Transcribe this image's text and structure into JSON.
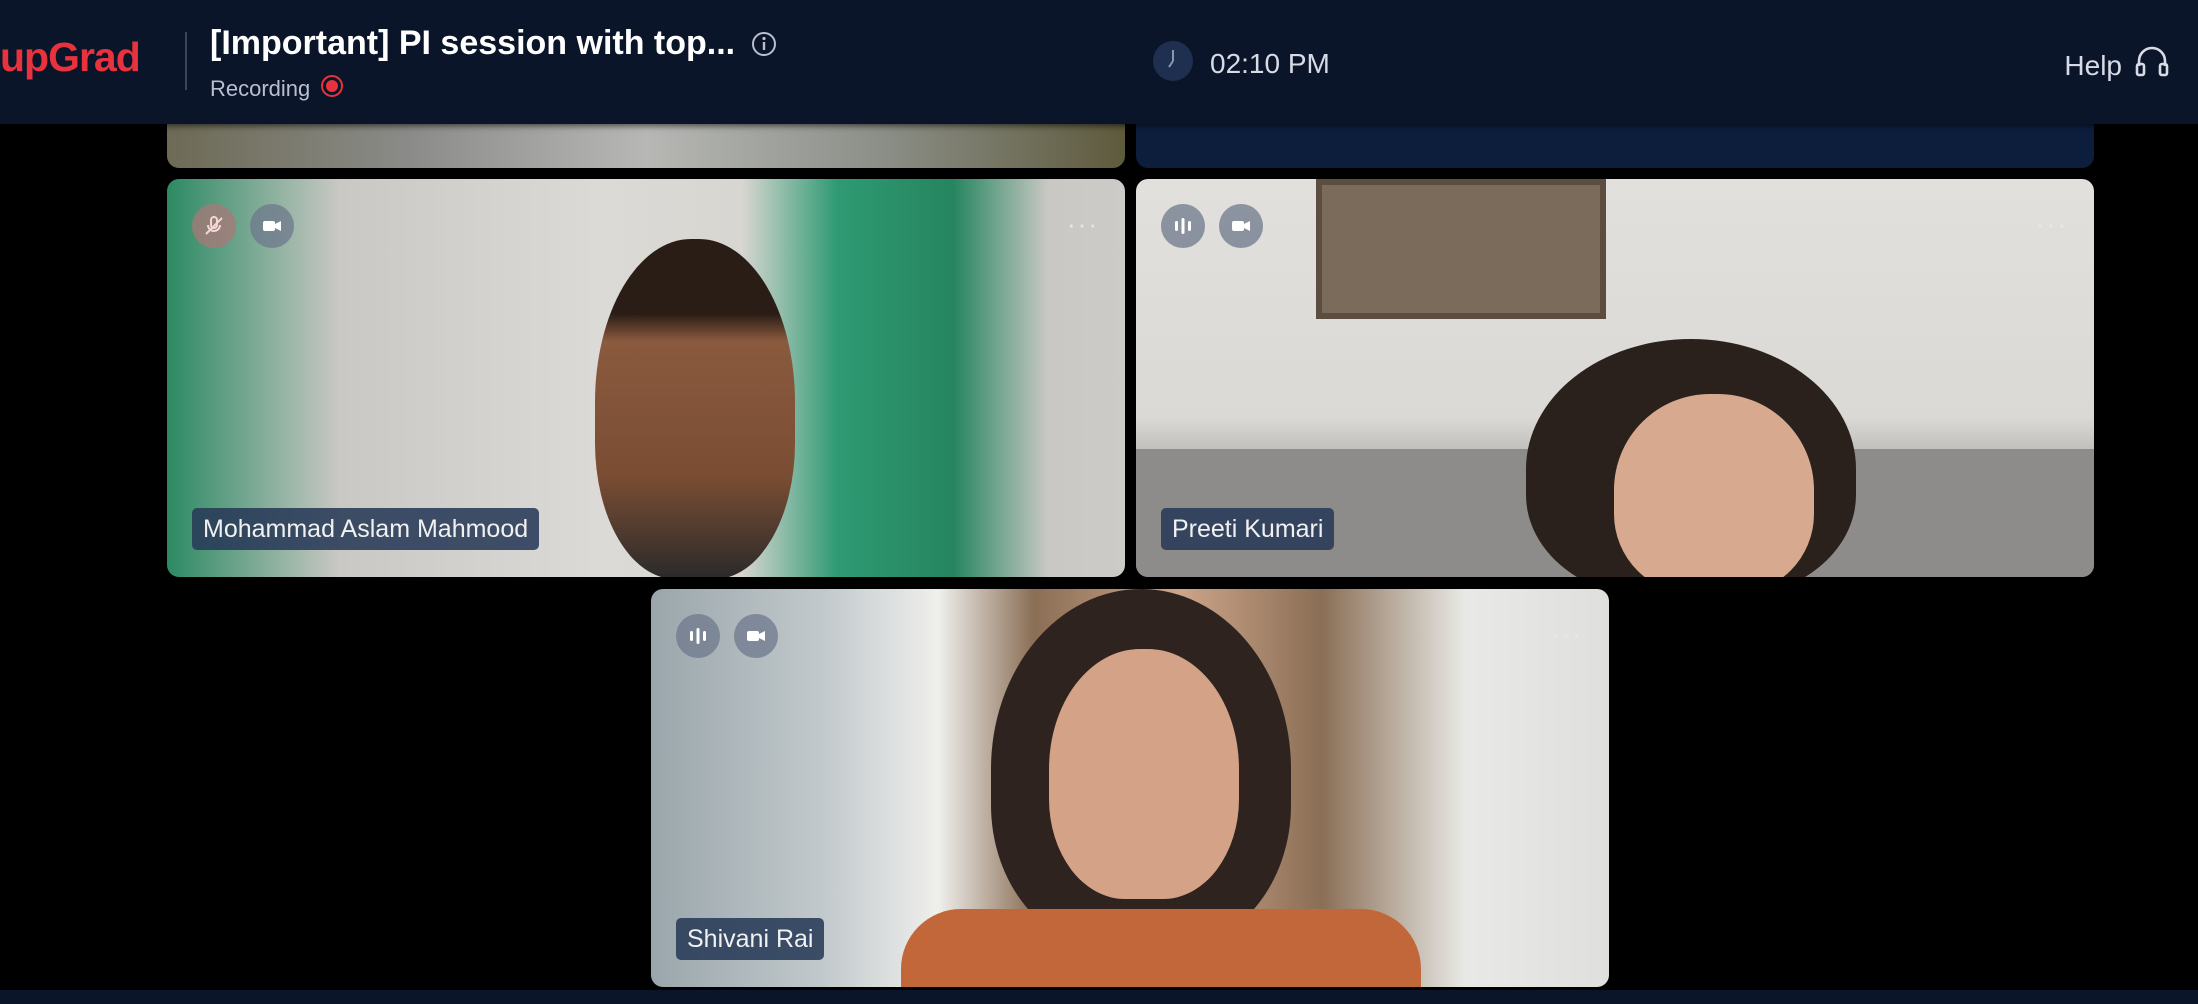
{
  "header": {
    "logo": "upGrad",
    "title": "[Important] PI session with top...",
    "recording_label": "Recording",
    "time": "02:10 PM",
    "help_label": "Help"
  },
  "participants": [
    {
      "name": "Mohammad Aslam Mahmood",
      "mic": "muted"
    },
    {
      "name": "Preeti Kumari",
      "mic": "active"
    },
    {
      "name": "Shivani Rai",
      "mic": "active"
    }
  ],
  "colors": {
    "brand": "#e8323d",
    "header_bg": "#0b1529",
    "recording_dot": "#e8323d",
    "name_tag_bg": "#283a58"
  }
}
